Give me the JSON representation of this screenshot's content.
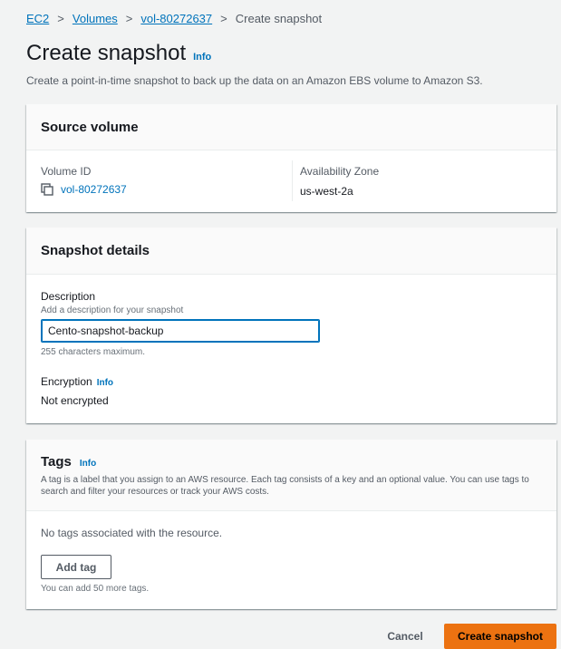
{
  "breadcrumb": {
    "items": [
      "EC2",
      "Volumes",
      "vol-80272637"
    ],
    "current": "Create snapshot",
    "separator": ">"
  },
  "page": {
    "title": "Create snapshot",
    "info": "Info",
    "description": "Create a point-in-time snapshot to back up the data on an Amazon EBS volume to Amazon S3."
  },
  "source_volume": {
    "title": "Source volume",
    "volume_id_label": "Volume ID",
    "volume_id": "vol-80272637",
    "az_label": "Availability Zone",
    "az_value": "us-west-2a"
  },
  "snapshot_details": {
    "title": "Snapshot details",
    "description_label": "Description",
    "description_hint": "Add a description for your snapshot",
    "description_value": "Cento-snapshot-backup",
    "description_constraint": "255 characters maximum.",
    "encryption_label": "Encryption",
    "encryption_info": "Info",
    "encryption_value": "Not encrypted"
  },
  "tags": {
    "title": "Tags",
    "info": "Info",
    "description": "A tag is a label that you assign to an AWS resource. Each tag consists of a key and an optional value. You can use tags to search and filter your resources or track your AWS costs.",
    "empty_text": "No tags associated with the resource.",
    "add_button": "Add tag",
    "limit_text": "You can add 50 more tags."
  },
  "footer": {
    "cancel": "Cancel",
    "create": "Create snapshot"
  },
  "colors": {
    "link": "#0073bb",
    "primary_button": "#ec7211",
    "background": "#f2f3f3"
  }
}
